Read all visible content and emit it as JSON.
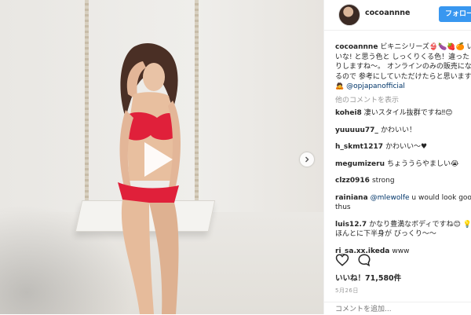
{
  "header": {
    "username": "cocoannne",
    "follow_label": "フォロー"
  },
  "caption": {
    "user": "cocoannne",
    "text": "ビキニシリーズ👙🍆🍓🍊 いいな! と思う色と しっくりくる色！違ったりしますね〜。 オンラインのみの販売になるので 参考にしていただけたらと思います🙇",
    "mention": "@opjapanofficial"
  },
  "more_comments_label": "他のコメントを表示",
  "comments": [
    {
      "user": "kohei8",
      "text": "凄いスタイル抜群ですね‼😊"
    },
    {
      "user": "yuuuuu77_",
      "text": "かわいい！"
    },
    {
      "user": "h_skmt1217",
      "text": "かわいい〜♥"
    },
    {
      "user": "megumizeru",
      "text": "ちょううらやましい😭"
    },
    {
      "user": "clzz0916",
      "text": "strong"
    },
    {
      "user": "rainiana",
      "mention": "@mlewolfe",
      "text": " u would look good thus"
    },
    {
      "user": "luis12.7",
      "text": "かなり豊満なボディですね😊 💡 ほんとに下半身が びっくり〜〜"
    },
    {
      "user": "ri_sa.xx.ikeda",
      "text": "www"
    }
  ],
  "likes": "いいね！71,580件",
  "date": "5月26日",
  "add_comment_placeholder": "コメントを追加...",
  "icons": {
    "heart": "heart-icon",
    "comment": "comment-icon",
    "play": "play-icon",
    "next": "chevron-right-icon"
  },
  "colors": {
    "accent": "#3897f0",
    "swimsuit": "#e0203a"
  }
}
